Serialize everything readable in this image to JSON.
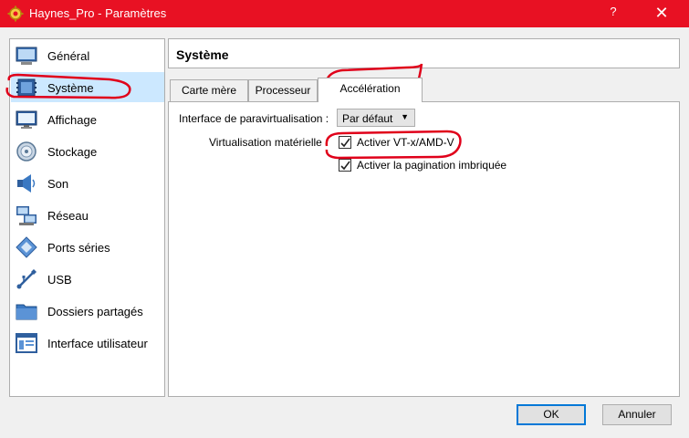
{
  "window": {
    "title": "Haynes_Pro - Paramètres",
    "help_label": "?",
    "close_label": "✕",
    "titlebar_color": "#e81123"
  },
  "sidebar": {
    "items": [
      {
        "label": "Général",
        "icon": "general-icon"
      },
      {
        "label": "Système",
        "icon": "system-icon",
        "selected": true
      },
      {
        "label": "Affichage",
        "icon": "display-icon"
      },
      {
        "label": "Stockage",
        "icon": "storage-icon"
      },
      {
        "label": "Son",
        "icon": "sound-icon"
      },
      {
        "label": "Réseau",
        "icon": "network-icon"
      },
      {
        "label": "Ports séries",
        "icon": "serial-ports-icon"
      },
      {
        "label": "USB",
        "icon": "usb-icon"
      },
      {
        "label": "Dossiers partagés",
        "icon": "shared-folders-icon"
      },
      {
        "label": "Interface utilisateur",
        "icon": "user-interface-icon"
      }
    ]
  },
  "page": {
    "title": "Système",
    "tabs": [
      {
        "label": "Carte mère"
      },
      {
        "label": "Processeur"
      },
      {
        "label": "Accélération",
        "active": true
      }
    ]
  },
  "acceleration": {
    "paravirt_label": "Interface de paravirtualisation :",
    "paravirt_value": "Par défaut",
    "hwvirt_label": "Virtualisation matérielle :",
    "vtx_label": "Activer VT-x/AMD-V",
    "vtx_checked": true,
    "nested_paging_label": "Activer la pagination imbriquée",
    "nested_paging_checked": true
  },
  "buttons": {
    "ok_label": "OK",
    "cancel_label": "Annuler"
  },
  "annotation_color": "#e0001a"
}
